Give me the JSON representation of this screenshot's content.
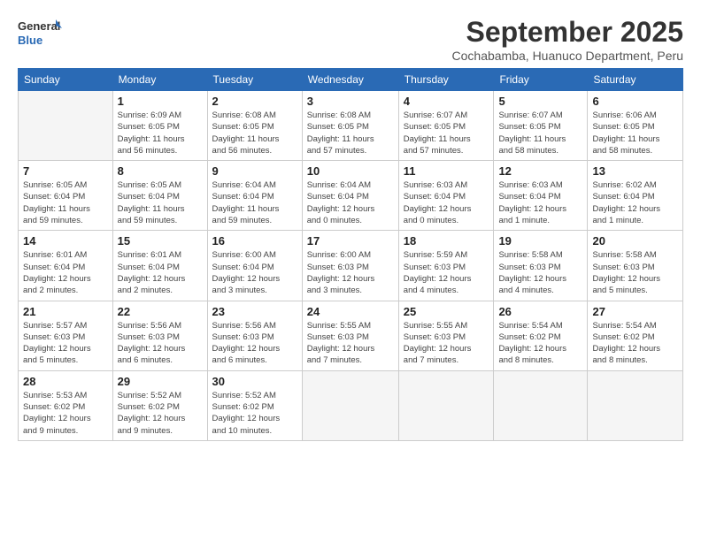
{
  "logo": {
    "line1": "General",
    "line2": "Blue"
  },
  "title": "September 2025",
  "subtitle": "Cochabamba, Huanuco Department, Peru",
  "days_of_week": [
    "Sunday",
    "Monday",
    "Tuesday",
    "Wednesday",
    "Thursday",
    "Friday",
    "Saturday"
  ],
  "weeks": [
    [
      {
        "day": "",
        "info": ""
      },
      {
        "day": "1",
        "info": "Sunrise: 6:09 AM\nSunset: 6:05 PM\nDaylight: 11 hours\nand 56 minutes."
      },
      {
        "day": "2",
        "info": "Sunrise: 6:08 AM\nSunset: 6:05 PM\nDaylight: 11 hours\nand 56 minutes."
      },
      {
        "day": "3",
        "info": "Sunrise: 6:08 AM\nSunset: 6:05 PM\nDaylight: 11 hours\nand 57 minutes."
      },
      {
        "day": "4",
        "info": "Sunrise: 6:07 AM\nSunset: 6:05 PM\nDaylight: 11 hours\nand 57 minutes."
      },
      {
        "day": "5",
        "info": "Sunrise: 6:07 AM\nSunset: 6:05 PM\nDaylight: 11 hours\nand 58 minutes."
      },
      {
        "day": "6",
        "info": "Sunrise: 6:06 AM\nSunset: 6:05 PM\nDaylight: 11 hours\nand 58 minutes."
      }
    ],
    [
      {
        "day": "7",
        "info": "Sunrise: 6:05 AM\nSunset: 6:04 PM\nDaylight: 11 hours\nand 59 minutes."
      },
      {
        "day": "8",
        "info": "Sunrise: 6:05 AM\nSunset: 6:04 PM\nDaylight: 11 hours\nand 59 minutes."
      },
      {
        "day": "9",
        "info": "Sunrise: 6:04 AM\nSunset: 6:04 PM\nDaylight: 11 hours\nand 59 minutes."
      },
      {
        "day": "10",
        "info": "Sunrise: 6:04 AM\nSunset: 6:04 PM\nDaylight: 12 hours\nand 0 minutes."
      },
      {
        "day": "11",
        "info": "Sunrise: 6:03 AM\nSunset: 6:04 PM\nDaylight: 12 hours\nand 0 minutes."
      },
      {
        "day": "12",
        "info": "Sunrise: 6:03 AM\nSunset: 6:04 PM\nDaylight: 12 hours\nand 1 minute."
      },
      {
        "day": "13",
        "info": "Sunrise: 6:02 AM\nSunset: 6:04 PM\nDaylight: 12 hours\nand 1 minute."
      }
    ],
    [
      {
        "day": "14",
        "info": "Sunrise: 6:01 AM\nSunset: 6:04 PM\nDaylight: 12 hours\nand 2 minutes."
      },
      {
        "day": "15",
        "info": "Sunrise: 6:01 AM\nSunset: 6:04 PM\nDaylight: 12 hours\nand 2 minutes."
      },
      {
        "day": "16",
        "info": "Sunrise: 6:00 AM\nSunset: 6:04 PM\nDaylight: 12 hours\nand 3 minutes."
      },
      {
        "day": "17",
        "info": "Sunrise: 6:00 AM\nSunset: 6:03 PM\nDaylight: 12 hours\nand 3 minutes."
      },
      {
        "day": "18",
        "info": "Sunrise: 5:59 AM\nSunset: 6:03 PM\nDaylight: 12 hours\nand 4 minutes."
      },
      {
        "day": "19",
        "info": "Sunrise: 5:58 AM\nSunset: 6:03 PM\nDaylight: 12 hours\nand 4 minutes."
      },
      {
        "day": "20",
        "info": "Sunrise: 5:58 AM\nSunset: 6:03 PM\nDaylight: 12 hours\nand 5 minutes."
      }
    ],
    [
      {
        "day": "21",
        "info": "Sunrise: 5:57 AM\nSunset: 6:03 PM\nDaylight: 12 hours\nand 5 minutes."
      },
      {
        "day": "22",
        "info": "Sunrise: 5:56 AM\nSunset: 6:03 PM\nDaylight: 12 hours\nand 6 minutes."
      },
      {
        "day": "23",
        "info": "Sunrise: 5:56 AM\nSunset: 6:03 PM\nDaylight: 12 hours\nand 6 minutes."
      },
      {
        "day": "24",
        "info": "Sunrise: 5:55 AM\nSunset: 6:03 PM\nDaylight: 12 hours\nand 7 minutes."
      },
      {
        "day": "25",
        "info": "Sunrise: 5:55 AM\nSunset: 6:03 PM\nDaylight: 12 hours\nand 7 minutes."
      },
      {
        "day": "26",
        "info": "Sunrise: 5:54 AM\nSunset: 6:02 PM\nDaylight: 12 hours\nand 8 minutes."
      },
      {
        "day": "27",
        "info": "Sunrise: 5:54 AM\nSunset: 6:02 PM\nDaylight: 12 hours\nand 8 minutes."
      }
    ],
    [
      {
        "day": "28",
        "info": "Sunrise: 5:53 AM\nSunset: 6:02 PM\nDaylight: 12 hours\nand 9 minutes."
      },
      {
        "day": "29",
        "info": "Sunrise: 5:52 AM\nSunset: 6:02 PM\nDaylight: 12 hours\nand 9 minutes."
      },
      {
        "day": "30",
        "info": "Sunrise: 5:52 AM\nSunset: 6:02 PM\nDaylight: 12 hours\nand 10 minutes."
      },
      {
        "day": "",
        "info": ""
      },
      {
        "day": "",
        "info": ""
      },
      {
        "day": "",
        "info": ""
      },
      {
        "day": "",
        "info": ""
      }
    ]
  ]
}
